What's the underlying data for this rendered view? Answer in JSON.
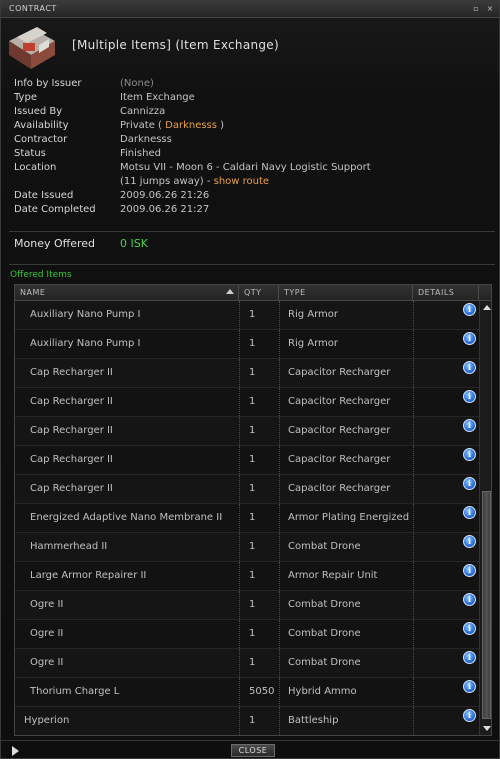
{
  "window": {
    "title": "CONTRACT",
    "minimize_glyph": "▫",
    "close_glyph": "×"
  },
  "header": {
    "icon": "contract-item-exchange-icon",
    "title": "[Multiple Items] (Item Exchange)"
  },
  "info": {
    "info_by_issuer": {
      "label": "Info by Issuer",
      "value": "(None)"
    },
    "type": {
      "label": "Type",
      "value": "Item Exchange"
    },
    "issued_by": {
      "label": "Issued By",
      "value": "Cannizza"
    },
    "availability": {
      "label": "Availability",
      "prefix": "Private ( ",
      "name": "Darknesss",
      "suffix": " )"
    },
    "contractor": {
      "label": "Contractor",
      "value": "Darknesss"
    },
    "status": {
      "label": "Status",
      "value": "Finished"
    },
    "location": {
      "label": "Location",
      "value": "Motsu VII - Moon 6 - Caldari Navy Logistic Support",
      "jumps": "(11 jumps away) - ",
      "route_link": "show route"
    },
    "date_issued": {
      "label": "Date Issued",
      "value": "2009.06.26  21:26"
    },
    "date_completed": {
      "label": "Date Completed",
      "value": "2009.06.26  21:27"
    }
  },
  "money": {
    "label": "Money Offered",
    "value": "0 ISK"
  },
  "offered": {
    "label": "Offered Items",
    "columns": {
      "name": "NAME",
      "qty": "QTY",
      "type": "TYPE",
      "details": "DETAILS"
    },
    "info_glyph": "i",
    "rows": [
      {
        "name": "Auxiliary Nano Pump I",
        "qty": "1",
        "type": "Rig Armor"
      },
      {
        "name": "Auxiliary Nano Pump I",
        "qty": "1",
        "type": "Rig Armor"
      },
      {
        "name": "Cap Recharger II",
        "qty": "1",
        "type": "Capacitor Recharger"
      },
      {
        "name": "Cap Recharger II",
        "qty": "1",
        "type": "Capacitor Recharger"
      },
      {
        "name": "Cap Recharger II",
        "qty": "1",
        "type": "Capacitor Recharger"
      },
      {
        "name": "Cap Recharger II",
        "qty": "1",
        "type": "Capacitor Recharger"
      },
      {
        "name": "Cap Recharger II",
        "qty": "1",
        "type": "Capacitor Recharger"
      },
      {
        "name": "Energized Adaptive Nano Membrane II",
        "qty": "1",
        "type": "Armor Plating Energized"
      },
      {
        "name": "Hammerhead II",
        "qty": "1",
        "type": "Combat Drone"
      },
      {
        "name": "Large Armor Repairer II",
        "qty": "1",
        "type": "Armor Repair Unit"
      },
      {
        "name": "Ogre II",
        "qty": "1",
        "type": "Combat Drone"
      },
      {
        "name": "Ogre II",
        "qty": "1",
        "type": "Combat Drone"
      },
      {
        "name": "Ogre II",
        "qty": "1",
        "type": "Combat Drone"
      },
      {
        "name": "Thorium Charge L",
        "qty": "5050",
        "type": "Hybrid Ammo"
      },
      {
        "name": "Hyperion",
        "qty": "1",
        "type": "Battleship"
      }
    ]
  },
  "footer": {
    "close_label": "CLOSE"
  }
}
